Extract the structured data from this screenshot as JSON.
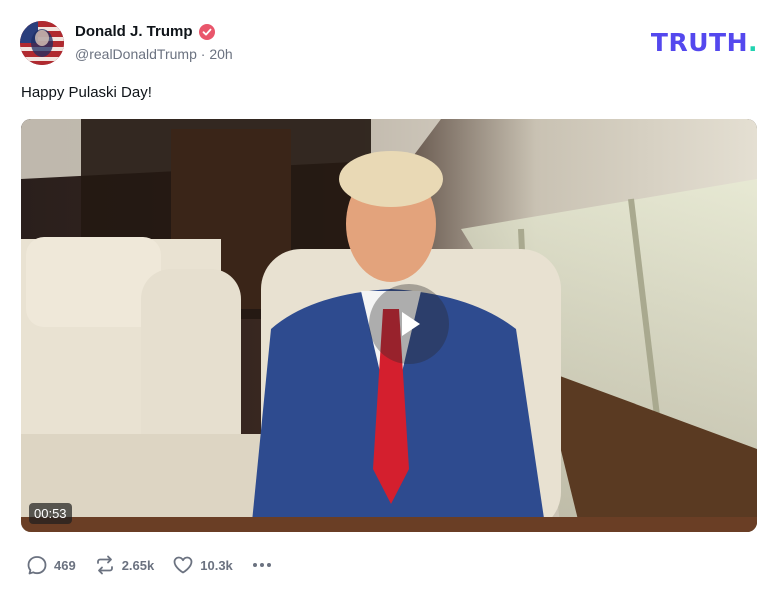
{
  "author": {
    "display_name": "Donald J. Trump",
    "handle": "@realDonaldTrump",
    "separator": "·",
    "time": "20h"
  },
  "brand": {
    "logo_text": "TRUTH",
    "logo_dot": ".",
    "logo_color": "#5448ee",
    "dot_color": "#21d3b0"
  },
  "post": {
    "text": "Happy Pulaski Day!"
  },
  "video": {
    "duration": "00:53"
  },
  "actions": {
    "replies": "469",
    "retruths": "2.65k",
    "likes": "10.3k"
  },
  "icons": [
    "verified-badge-icon",
    "play-icon",
    "reply-icon",
    "retruth-icon",
    "like-icon",
    "more-icon"
  ]
}
